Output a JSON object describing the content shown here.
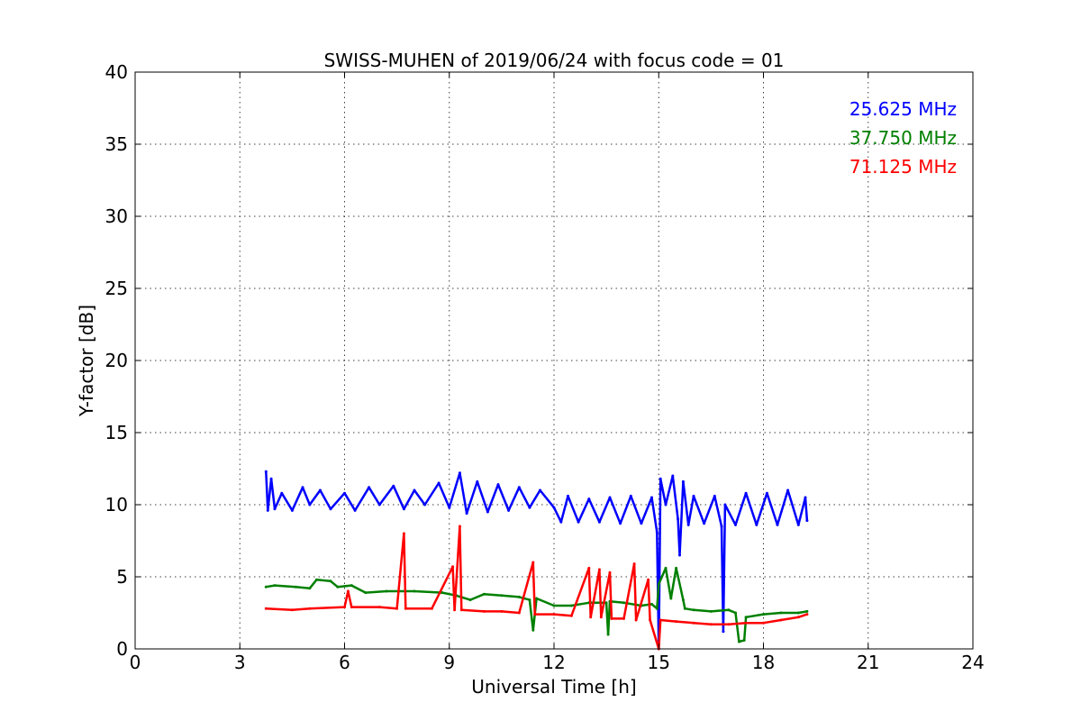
{
  "chart_data": {
    "type": "line",
    "title": "SWISS-MUHEN of 2019/06/24 with focus code = 01",
    "xlabel": "Universal Time [h]",
    "ylabel": "Y-factor [dB]",
    "xlim": [
      0,
      24
    ],
    "ylim": [
      0,
      40
    ],
    "xticks": [
      0,
      3,
      6,
      9,
      12,
      15,
      18,
      21,
      24
    ],
    "yticks": [
      0,
      5,
      10,
      15,
      20,
      25,
      30,
      35,
      40
    ],
    "xtick_labels": [
      "0",
      "3",
      "6",
      "9",
      "12",
      "15",
      "18",
      "21",
      "24"
    ],
    "ytick_labels": [
      "0",
      "5",
      "10",
      "15",
      "20",
      "25",
      "30",
      "35",
      "40"
    ],
    "grid": true,
    "legend_position": "top-right",
    "series": [
      {
        "name": "25.625 MHz",
        "color": "#0000ff",
        "points": [
          [
            3.75,
            12.3
          ],
          [
            3.8,
            9.6
          ],
          [
            3.9,
            11.8
          ],
          [
            4.0,
            9.7
          ],
          [
            4.2,
            10.8
          ],
          [
            4.5,
            9.6
          ],
          [
            4.8,
            11.2
          ],
          [
            5.0,
            10.0
          ],
          [
            5.3,
            11.0
          ],
          [
            5.6,
            9.7
          ],
          [
            6.0,
            10.8
          ],
          [
            6.3,
            9.6
          ],
          [
            6.7,
            11.2
          ],
          [
            7.0,
            10.0
          ],
          [
            7.4,
            11.3
          ],
          [
            7.7,
            9.7
          ],
          [
            8.0,
            11.0
          ],
          [
            8.3,
            10.0
          ],
          [
            8.7,
            11.5
          ],
          [
            9.0,
            9.8
          ],
          [
            9.3,
            12.2
          ],
          [
            9.5,
            9.4
          ],
          [
            9.8,
            11.6
          ],
          [
            10.1,
            9.5
          ],
          [
            10.4,
            11.4
          ],
          [
            10.7,
            9.6
          ],
          [
            11.0,
            11.2
          ],
          [
            11.3,
            9.8
          ],
          [
            11.6,
            11.0
          ],
          [
            12.0,
            9.8
          ],
          [
            12.2,
            8.8
          ],
          [
            12.4,
            10.6
          ],
          [
            12.7,
            8.8
          ],
          [
            13.0,
            10.4
          ],
          [
            13.3,
            8.8
          ],
          [
            13.6,
            10.5
          ],
          [
            13.9,
            8.7
          ],
          [
            14.2,
            10.6
          ],
          [
            14.5,
            8.7
          ],
          [
            14.8,
            10.5
          ],
          [
            14.95,
            8.1
          ],
          [
            15.0,
            0.0
          ],
          [
            15.05,
            11.8
          ],
          [
            15.2,
            10.0
          ],
          [
            15.4,
            12.0
          ],
          [
            15.55,
            9.0
          ],
          [
            15.6,
            6.5
          ],
          [
            15.7,
            11.6
          ],
          [
            15.85,
            8.6
          ],
          [
            16.0,
            10.6
          ],
          [
            16.3,
            8.7
          ],
          [
            16.6,
            10.6
          ],
          [
            16.8,
            8.5
          ],
          [
            16.85,
            1.2
          ],
          [
            16.9,
            10.0
          ],
          [
            17.2,
            8.6
          ],
          [
            17.5,
            10.8
          ],
          [
            17.8,
            8.6
          ],
          [
            18.1,
            10.8
          ],
          [
            18.4,
            8.6
          ],
          [
            18.7,
            11.0
          ],
          [
            19.0,
            8.6
          ],
          [
            19.2,
            10.5
          ],
          [
            19.25,
            8.9
          ]
        ]
      },
      {
        "name": "37.750 MHz",
        "color": "#008000",
        "points": [
          [
            3.75,
            4.3
          ],
          [
            4.0,
            4.4
          ],
          [
            4.6,
            4.3
          ],
          [
            5.0,
            4.2
          ],
          [
            5.2,
            4.8
          ],
          [
            5.6,
            4.7
          ],
          [
            5.8,
            4.3
          ],
          [
            6.2,
            4.4
          ],
          [
            6.6,
            3.9
          ],
          [
            7.2,
            4.0
          ],
          [
            8.0,
            4.0
          ],
          [
            8.8,
            3.9
          ],
          [
            9.2,
            3.7
          ],
          [
            9.6,
            3.4
          ],
          [
            10.0,
            3.8
          ],
          [
            10.5,
            3.7
          ],
          [
            11.0,
            3.6
          ],
          [
            11.3,
            3.4
          ],
          [
            11.4,
            1.3
          ],
          [
            11.5,
            3.5
          ],
          [
            12.0,
            3.0
          ],
          [
            12.5,
            3.0
          ],
          [
            13.0,
            3.2
          ],
          [
            13.5,
            3.2
          ],
          [
            13.55,
            1.0
          ],
          [
            13.6,
            3.3
          ],
          [
            14.0,
            3.2
          ],
          [
            14.5,
            3.0
          ],
          [
            14.8,
            3.1
          ],
          [
            14.95,
            2.8
          ],
          [
            15.0,
            4.5
          ],
          [
            15.2,
            5.6
          ],
          [
            15.35,
            3.5
          ],
          [
            15.5,
            5.6
          ],
          [
            15.7,
            3.4
          ],
          [
            15.75,
            2.8
          ],
          [
            16.0,
            2.7
          ],
          [
            16.5,
            2.6
          ],
          [
            17.0,
            2.7
          ],
          [
            17.2,
            2.5
          ],
          [
            17.3,
            0.5
          ],
          [
            17.45,
            0.6
          ],
          [
            17.5,
            2.2
          ],
          [
            18.0,
            2.4
          ],
          [
            18.5,
            2.5
          ],
          [
            19.0,
            2.5
          ],
          [
            19.25,
            2.6
          ]
        ]
      },
      {
        "name": "71.125 MHz",
        "color": "#ff0000",
        "points": [
          [
            3.75,
            2.8
          ],
          [
            4.5,
            2.7
          ],
          [
            5.0,
            2.8
          ],
          [
            6.0,
            2.9
          ],
          [
            6.1,
            4.0
          ],
          [
            6.2,
            2.9
          ],
          [
            7.0,
            2.9
          ],
          [
            7.5,
            2.8
          ],
          [
            7.7,
            8.0
          ],
          [
            7.75,
            2.8
          ],
          [
            8.5,
            2.8
          ],
          [
            9.1,
            5.7
          ],
          [
            9.15,
            2.7
          ],
          [
            9.3,
            8.5
          ],
          [
            9.35,
            2.7
          ],
          [
            10.0,
            2.6
          ],
          [
            10.5,
            2.6
          ],
          [
            11.0,
            2.5
          ],
          [
            11.4,
            6.0
          ],
          [
            11.45,
            2.4
          ],
          [
            12.0,
            2.4
          ],
          [
            12.5,
            2.3
          ],
          [
            13.0,
            5.6
          ],
          [
            13.05,
            2.2
          ],
          [
            13.3,
            5.5
          ],
          [
            13.35,
            2.2
          ],
          [
            13.6,
            5.3
          ],
          [
            13.65,
            2.1
          ],
          [
            14.0,
            2.1
          ],
          [
            14.3,
            5.9
          ],
          [
            14.35,
            2.0
          ],
          [
            14.7,
            4.8
          ],
          [
            14.75,
            2.0
          ],
          [
            15.0,
            0.0
          ],
          [
            15.05,
            2.0
          ],
          [
            15.5,
            1.9
          ],
          [
            16.0,
            1.8
          ],
          [
            16.5,
            1.7
          ],
          [
            17.0,
            1.7
          ],
          [
            17.5,
            1.8
          ],
          [
            18.0,
            1.8
          ],
          [
            18.5,
            2.0
          ],
          [
            19.0,
            2.2
          ],
          [
            19.25,
            2.4
          ]
        ]
      }
    ]
  }
}
